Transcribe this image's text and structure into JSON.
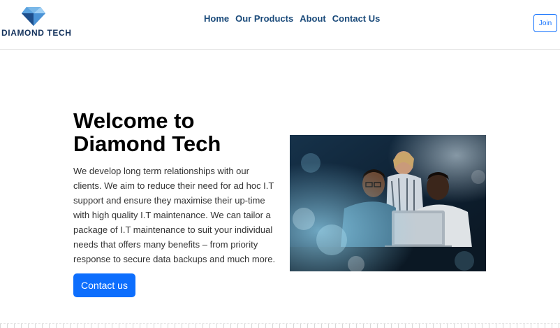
{
  "brand": {
    "name": "DIAMOND TECH",
    "logo_icon": "diamond-icon",
    "color": "#14325c"
  },
  "nav": {
    "links": [
      "Home",
      "Our Products",
      "About",
      "Contact Us"
    ],
    "join_label": "Join"
  },
  "hero": {
    "title": "Welcome to Diamond Tech",
    "text": "We develop long term relationships with our clients. We aim to reduce their need for ad hoc I.T support and ensure they maximise their up-time with high quality I.T maintenance. We can tailor a package of I.T maintenance to suit your individual needs that offers many benefits – from priority response to secure data backups and much more.",
    "cta_label": "Contact us",
    "image_subject": "three-people-at-laptop-photo"
  },
  "colors": {
    "primary": "#0d6efd",
    "nav_link": "#1a4a7a"
  }
}
